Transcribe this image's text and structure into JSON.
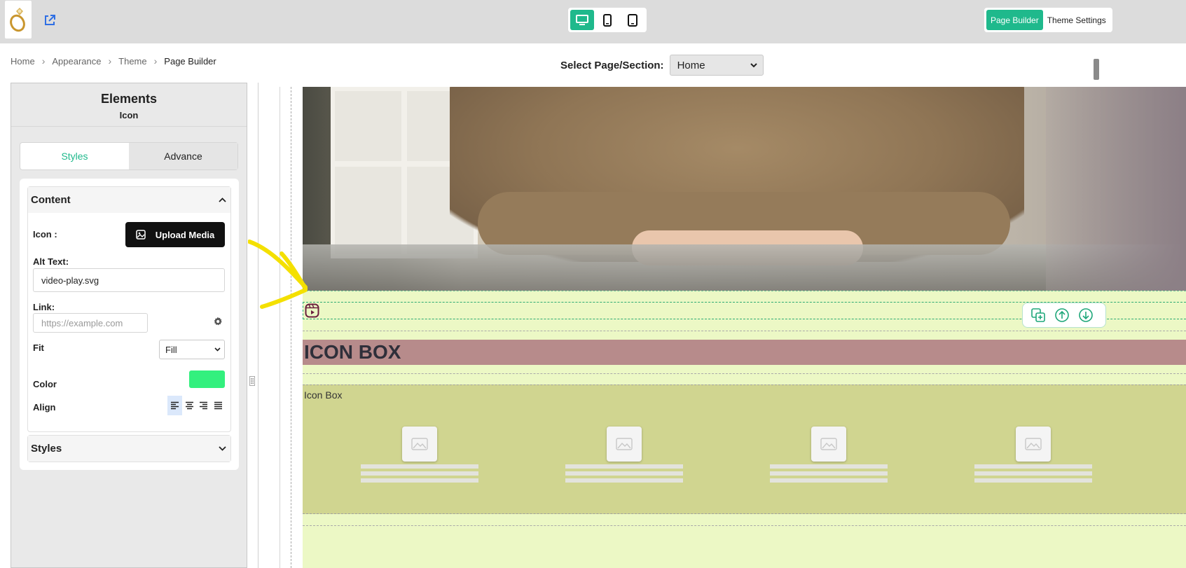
{
  "topbar": {
    "logo_icon": "ring-logo-icon",
    "external_link_icon": "external-link-icon",
    "devices": [
      {
        "icon": "desktop-icon",
        "active": true
      },
      {
        "icon": "mobile-icon",
        "active": false
      },
      {
        "icon": "tablet-icon",
        "active": false
      }
    ],
    "tabs": {
      "page_builder": "Page Builder",
      "theme_settings": "Theme Settings"
    },
    "accent": "#1fb98c"
  },
  "breadcrumb": {
    "items": [
      "Home",
      "Appearance",
      "Theme",
      "Page Builder"
    ]
  },
  "page_select": {
    "label": "Select Page/Section:",
    "selected": "Home"
  },
  "sidebar": {
    "title": "Elements",
    "subtitle": "Icon",
    "tabs": {
      "styles": "Styles",
      "advance": "Advance"
    },
    "content_section": {
      "header": "Content",
      "icon_label": "Icon :",
      "upload_button": "Upload Media",
      "alt_text_label": "Alt Text:",
      "alt_text_value": "video-play.svg",
      "link_label": "Link:",
      "link_placeholder": "https://example.com",
      "fit_label": "Fit",
      "fit_value": "Fill",
      "color_label": "Color",
      "color_value": "#33f07e",
      "align_label": "Align",
      "align_options": [
        "align-left-icon",
        "align-center-icon",
        "align-right-icon",
        "align-justify-icon"
      ],
      "align_selected": "align-left-icon"
    },
    "styles_section": {
      "header": "Styles"
    }
  },
  "canvas": {
    "heading": "ICON BOX",
    "icon_box_label": "Icon Box",
    "selected_icon": "video-play-icon",
    "tools": [
      "duplicate-icon",
      "move-up-icon",
      "move-down-icon"
    ],
    "placeholder_cards": 4,
    "colors": {
      "section_light": "#ecf8c5",
      "heading_bg": "#b78b8b",
      "iconbox_bg": "#d0d590"
    }
  }
}
